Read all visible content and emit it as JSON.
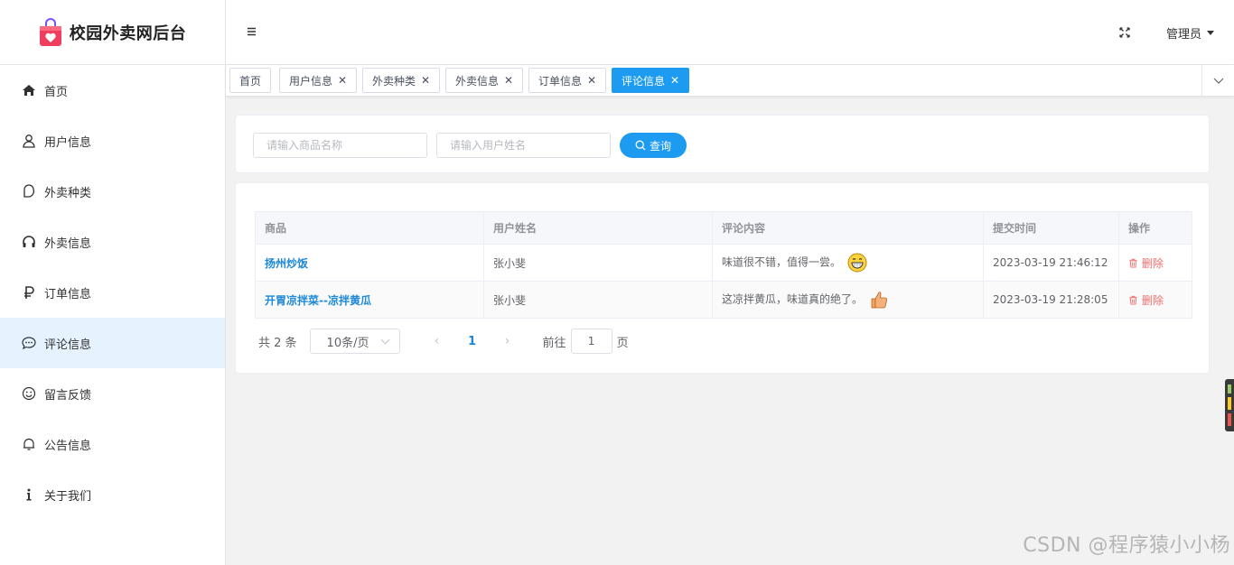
{
  "app": {
    "title": "校园外卖网后台"
  },
  "header": {
    "user": "管理员"
  },
  "sidebar": {
    "items": [
      {
        "label": "首页",
        "icon": "home-icon"
      },
      {
        "label": "用户信息",
        "icon": "user-icon"
      },
      {
        "label": "外卖种类",
        "icon": "category-icon"
      },
      {
        "label": "外卖信息",
        "icon": "headset-icon"
      },
      {
        "label": "订单信息",
        "icon": "ruble-icon"
      },
      {
        "label": "评论信息",
        "icon": "chat-icon",
        "active": true
      },
      {
        "label": "留言反馈",
        "icon": "smile-icon"
      },
      {
        "label": "公告信息",
        "icon": "bell-icon"
      },
      {
        "label": "关于我们",
        "icon": "info-icon"
      }
    ]
  },
  "tabs": [
    {
      "label": "首页",
      "closable": false
    },
    {
      "label": "用户信息",
      "closable": true
    },
    {
      "label": "外卖种类",
      "closable": true
    },
    {
      "label": "外卖信息",
      "closable": true
    },
    {
      "label": "订单信息",
      "closable": true
    },
    {
      "label": "评论信息",
      "closable": true,
      "active": true
    }
  ],
  "search": {
    "product_placeholder": "请输入商品名称",
    "user_placeholder": "请输入用户姓名",
    "button": "查询"
  },
  "table": {
    "columns": [
      "商品",
      "用户姓名",
      "评论内容",
      "提交时间",
      "操作"
    ],
    "rows": [
      {
        "product": "扬州炒饭",
        "user": "张小斐",
        "comment": "味道很不错，值得一尝。",
        "emoji": "grin",
        "time": "2023-03-19 21:46:12",
        "action": "删除"
      },
      {
        "product": "开胃凉拌菜--凉拌黄瓜",
        "user": "张小斐",
        "comment": "这凉拌黄瓜，味道真的绝了。",
        "emoji": "thumbs-up",
        "time": "2023-03-19 21:28:05",
        "action": "删除"
      }
    ]
  },
  "pagination": {
    "total": "共 2 条",
    "page_size": "10条/页",
    "current": "1",
    "goto_prefix": "前往",
    "goto_value": "1",
    "goto_suffix": "页"
  },
  "watermark": "CSDN @程序猿小小杨",
  "colors": {
    "accent": "#1d9bf0",
    "danger": "#f56c6c",
    "active_bg": "#e6f3ff"
  }
}
